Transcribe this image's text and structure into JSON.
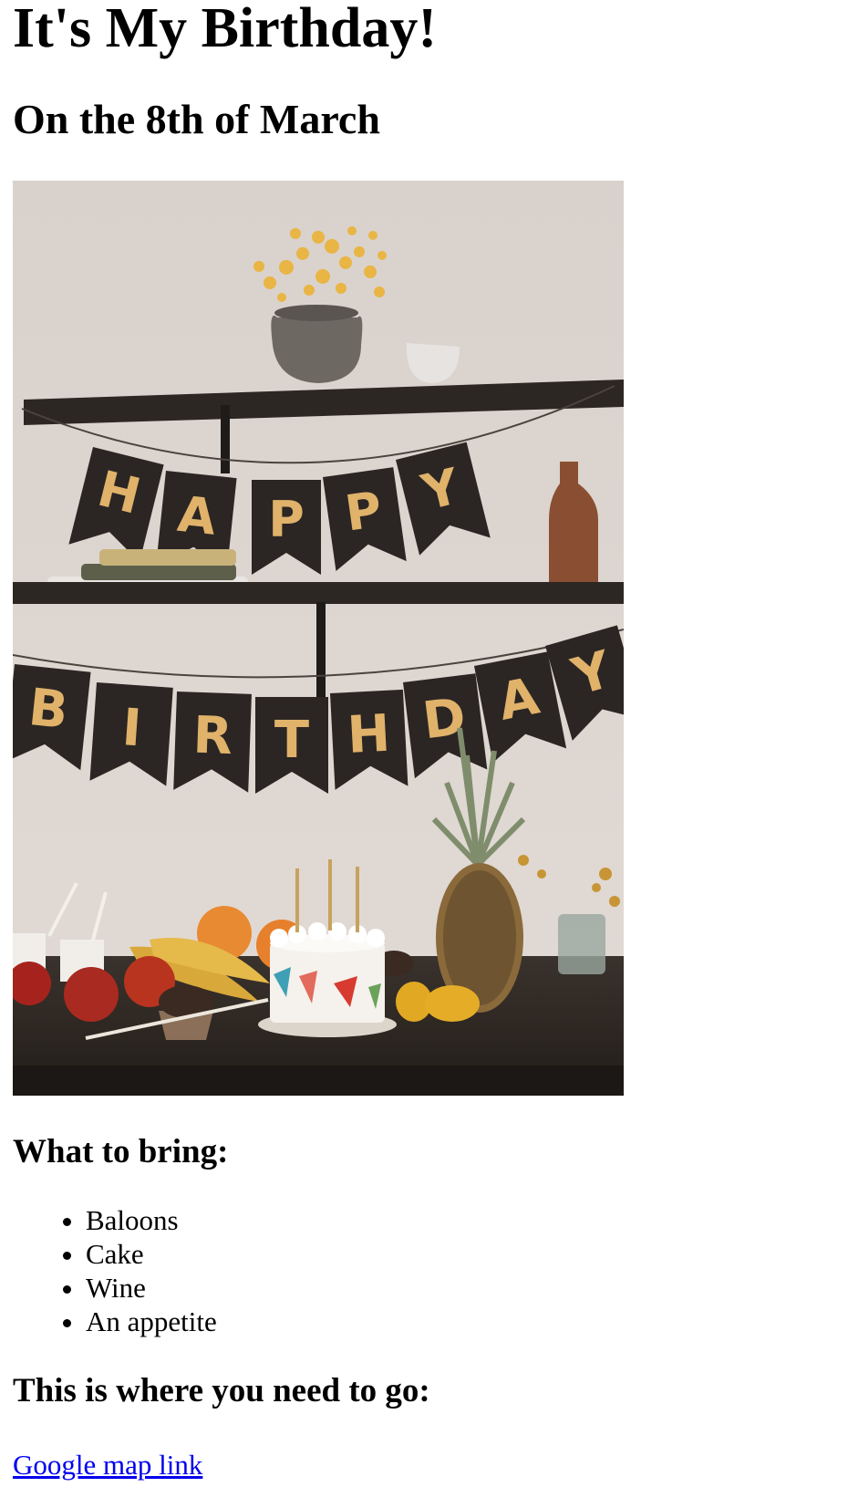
{
  "page": {
    "title": "It's My Birthday!",
    "date": "On the 8th of March"
  },
  "photo": {
    "banner_top": [
      "H",
      "A",
      "P",
      "P",
      "Y"
    ],
    "banner_bottom": [
      "B",
      "I",
      "R",
      "T",
      "H",
      "D",
      "A",
      "Y"
    ]
  },
  "bring": {
    "heading": "What to bring:",
    "items": [
      "Baloons",
      "Cake",
      "Wine",
      "An appetite"
    ]
  },
  "location": {
    "heading": "This is where you need to go:",
    "link_text": "Google map link"
  },
  "colors": {
    "link": "#0000ee",
    "wall": "#ddd5cf",
    "shelf": "#2d2723",
    "pennant": "#2b2624",
    "letter_gold": "#e0b26a"
  }
}
